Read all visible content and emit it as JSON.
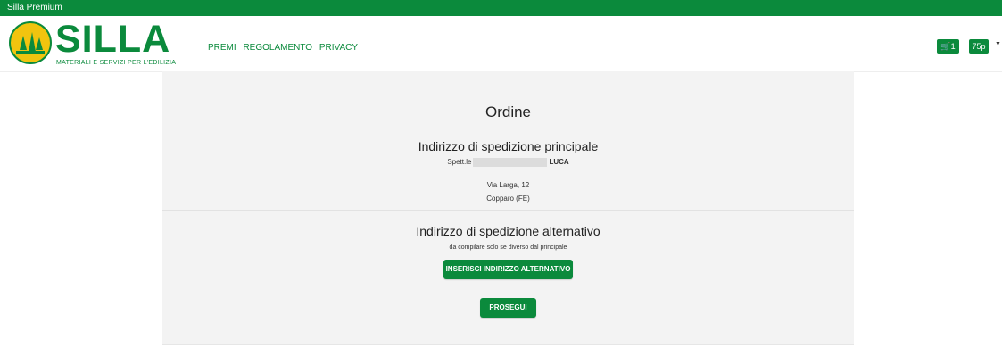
{
  "topbar": {
    "title": "Silla Premium"
  },
  "brand": {
    "name": "SILLA",
    "tagline": "MATERIALI E SERVIZI PER L'EDILIZIA",
    "primary_color": "#0b8a3c",
    "accent_color": "#f1c40f"
  },
  "nav": {
    "items": [
      "PREMI",
      "REGOLAMENTO",
      "PRIVACY"
    ]
  },
  "header_right": {
    "cart_count": "1",
    "points": "75p"
  },
  "order": {
    "title": "Ordine",
    "primary_address": {
      "heading": "Indirizzo di spedizione principale",
      "name_prefix": "Spett.le",
      "name_suffix": "LUCA",
      "street": "Via Larga, 12",
      "city": "Copparo (FE)"
    },
    "alternate_address": {
      "heading": "Indirizzo di spedizione alternativo",
      "note": "da compilare solo se diverso dal principale",
      "button_label": "INSERISCI INDIRIZZO ALTERNATIVO"
    },
    "proceed_label": "PROSEGUI"
  }
}
